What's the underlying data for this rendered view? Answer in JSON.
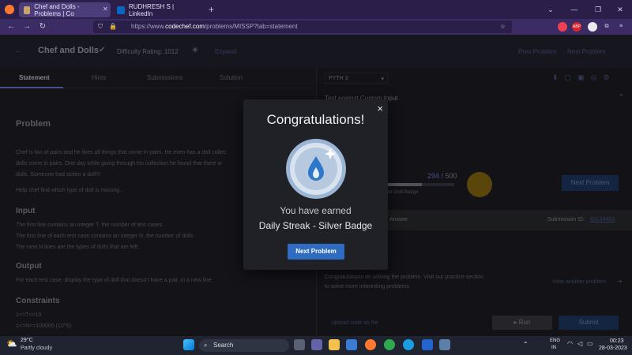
{
  "browser": {
    "tabs": [
      {
        "label": "Chef and Dolls - Problems | Co"
      },
      {
        "label": "RUDHRESH S | LinkedIn"
      }
    ],
    "new_tab": "+",
    "url_prefix": "https://www.",
    "url_host": "codechef.com",
    "url_path": "/problems/MISSP?tab=statement"
  },
  "problem_header": {
    "title": "Chef and Dolls",
    "difficulty": "Difficulty Rating: 1012",
    "expand": "Expand",
    "prev": "Prev Problem",
    "next": "Next Problem"
  },
  "left_tabs": [
    "Statement",
    "Hints",
    "Submissions",
    "Solution"
  ],
  "statement": {
    "heading": "Problem",
    "p1": "Chef is fan of pairs and he likes all things that come in pairs. He even has a doll collec",
    "p2": "dolls come in pairs. One day while going through his collection he found that there w",
    "p3": "dolls. Someone had stolen a doll!!!",
    "p4": "Help chef find which type of doll is missing..",
    "input_h": "Input",
    "in1": "The first line contains an integer T, the number of test cases.",
    "in2": "The first line of each test case contains an integer N, the number of dolls.",
    "in3": "The next N lines are the types of dolls that are left.",
    "output_h": "Output",
    "out1": "For each test case, display the type of doll that doesn't have a pair, in a new line.",
    "constraints_h": "Constraints",
    "c1": "1<=T<=10",
    "c2": "1<=N<=100000 (10^5)"
  },
  "editor": {
    "language": "PYTH 3",
    "test_label": "Test against Custom Input",
    "progress_value": "294",
    "progress_total": "/ 500",
    "progress_fraction": 0.588,
    "badge_hint": "to get Gold Badge",
    "next_problem": "Next Problem",
    "answer_status": "Answer",
    "submission_label": "Submission ID:",
    "submission_id": "93134463",
    "congrats_note_1": "Congratulations on solving the problem. Visit our practice section",
    "congrats_note_2": "to solve more interesting problems",
    "view_another": "View another problem",
    "upload": "Upload code as file",
    "run": "Run",
    "submit": "Submit"
  },
  "modal": {
    "close": "×",
    "title": "Congratulations!",
    "earned": "You have earned",
    "badge_name": "Daily Streak - Silver Badge",
    "button": "Next Problem"
  },
  "taskbar": {
    "temp": "29°C",
    "weather": "Partly cloudy",
    "search": "Search",
    "lang": "ENG",
    "region": "IN",
    "time": "00:23",
    "date": "28-03-2023"
  },
  "colors": {
    "accent": "#2f6bbf",
    "browser_bg": "#2b1f4a",
    "modal_bg": "#202126"
  }
}
